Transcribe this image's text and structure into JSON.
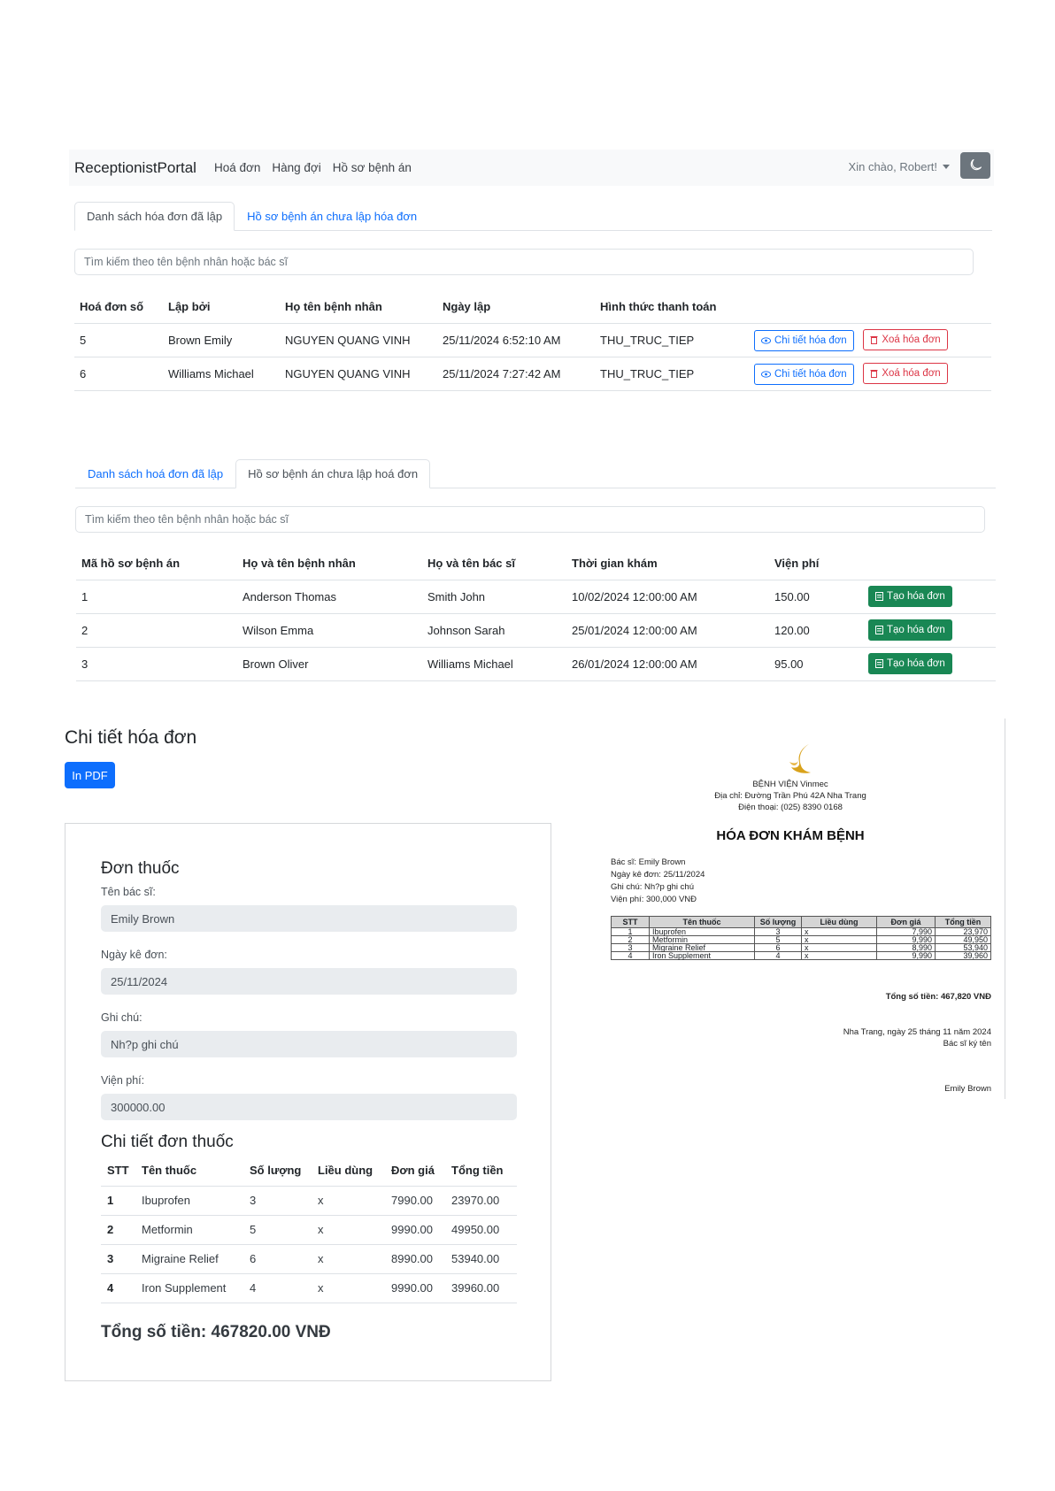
{
  "navbar": {
    "brand": "ReceptionistPortal",
    "links": [
      "Hoá đơn",
      "Hàng đợi",
      "Hồ sơ bệnh án"
    ],
    "greeting": "Xin chào, Robert!"
  },
  "section1": {
    "tabs": [
      "Danh sách hóa đơn đã lập",
      "Hồ sơ bệnh án chưa lập hóa đơn"
    ],
    "search_placeholder": "Tìm kiếm theo tên bệnh nhân hoặc bác sĩ",
    "headers": [
      "Hoá đơn số",
      "Lập bởi",
      "Họ tên bệnh nhân",
      "Ngày lập",
      "Hình thức thanh toán"
    ],
    "rows": [
      [
        "5",
        "Brown Emily",
        "NGUYEN QUANG VINH",
        "25/11/2024 6:52:10 AM",
        "THU_TRUC_TIEP"
      ],
      [
        "6",
        "Williams Michael",
        "NGUYEN QUANG VINH",
        "25/11/2024 7:27:42 AM",
        "THU_TRUC_TIEP"
      ]
    ],
    "detail_btn": "Chi tiết hóa đơn",
    "delete_btn": "Xoá hóa đơn"
  },
  "section2": {
    "tabs": [
      "Danh sách hoá đơn đã lập",
      "Hồ sơ bệnh án chưa lập hoá đơn"
    ],
    "search_placeholder": "Tìm kiếm theo tên bệnh nhân hoặc bác sĩ",
    "headers": [
      "Mã hồ sơ bệnh án",
      "Họ và tên bệnh nhân",
      "Họ và tên bác sĩ",
      "Thời gian khám",
      "Viện phí"
    ],
    "rows": [
      [
        "1",
        "Anderson Thomas",
        "Smith John",
        "10/02/2024 12:00:00 AM",
        "150.00"
      ],
      [
        "2",
        "Wilson Emma",
        "Johnson Sarah",
        "25/01/2024 12:00:00 AM",
        "120.00"
      ],
      [
        "3",
        "Brown Oliver",
        "Williams Michael",
        "26/01/2024 12:00:00 AM",
        "95.00"
      ]
    ],
    "create_btn": "Tạo hóa đơn"
  },
  "detail": {
    "heading": "Chi tiết hóa đơn",
    "pdf_btn": "In PDF",
    "card_title": "Đơn thuốc",
    "doctor_label": "Tên bác sĩ:",
    "doctor_value": "Emily Brown",
    "date_label": "Ngày kê đơn:",
    "date_value": "25/11/2024",
    "note_label": "Ghi chú:",
    "note_value": "Nh?p ghi chú",
    "fee_label": "Viện phí:",
    "fee_value": "300000.00",
    "rx_title": "Chi tiết đơn thuốc",
    "rx_headers": [
      "STT",
      "Tên thuốc",
      "Số lượng",
      "Liều dùng",
      "Đơn giá",
      "Tổng tiền"
    ],
    "rx_rows": [
      [
        "1",
        "Ibuprofen",
        "3",
        "x",
        "7990.00",
        "23970.00"
      ],
      [
        "2",
        "Metformin",
        "5",
        "x",
        "9990.00",
        "49950.00"
      ],
      [
        "3",
        "Migraine Relief",
        "6",
        "x",
        "8990.00",
        "53940.00"
      ],
      [
        "4",
        "Iron Supplement",
        "4",
        "x",
        "9990.00",
        "39960.00"
      ]
    ],
    "total": "Tổng số tiền: 467820.00 VNĐ"
  },
  "pdf": {
    "hospital": "BỆNH VIỆN Vinmec",
    "address": "Địa chỉ: Đường Trần Phú 42A Nha Trang",
    "phone": "Điện thoại: (025) 8390 0168",
    "title": "HÓA ĐƠN KHÁM BỆNH",
    "info": [
      "Bác sĩ: Emily Brown",
      "Ngày kê đơn: 25/11/2024",
      "Ghi chú: Nh?p ghi chú",
      "Viện phí: 300,000 VNĐ"
    ],
    "headers": [
      "STT",
      "Tên thuốc",
      "Số lượng",
      "Liều dùng",
      "Đơn giá",
      "Tổng tiền"
    ],
    "rows": [
      [
        "1",
        "Ibuprofen",
        "3",
        "x",
        "7,990",
        "23,970"
      ],
      [
        "2",
        "Metformin",
        "5",
        "x",
        "9,990",
        "49,950"
      ],
      [
        "3",
        "Migraine Relief",
        "6",
        "x",
        "8,990",
        "53,940"
      ],
      [
        "4",
        "Iron Supplement",
        "4",
        "x",
        "9,990",
        "39,960"
      ]
    ],
    "total": "Tổng số tiền: 467,820 VNĐ",
    "place_date": "Nha Trang, ngày 25 tháng 11 năm 2024",
    "sign_label": "Bác sĩ ký tên",
    "signer": "Emily Brown"
  },
  "colors": {
    "primary": "#0d6efd",
    "success": "#198754",
    "danger": "#dc3545",
    "logo_gold": "#d9a21b"
  }
}
